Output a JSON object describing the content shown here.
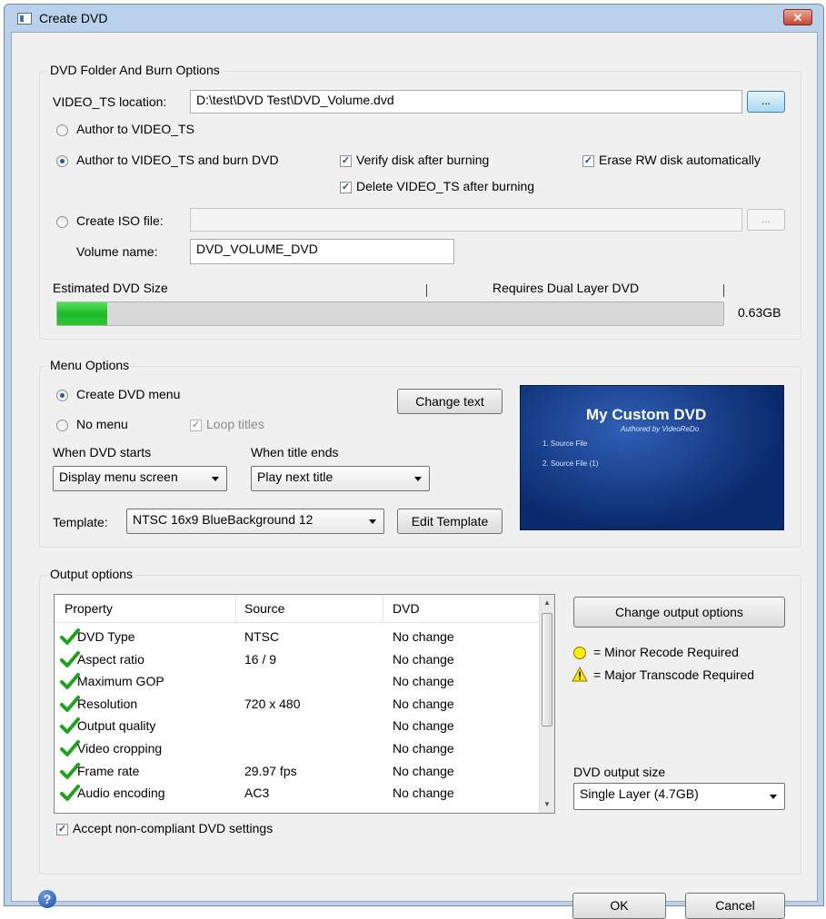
{
  "window": {
    "title": "Create DVD",
    "close_label": "✕"
  },
  "burn_options": {
    "title": "DVD Folder And Burn Options",
    "video_ts_label": "VIDEO_TS location:",
    "video_ts_value": "D:\\test\\DVD Test\\DVD_Volume.dvd",
    "browse_label": "...",
    "author_only_label": "Author to VIDEO_TS",
    "author_burn_label": "Author to VIDEO_TS and burn DVD",
    "verify_label": "Verify disk after burning",
    "erase_rw_label": "Erase RW disk automatically",
    "delete_vts_label": "Delete VIDEO_TS after burning",
    "iso_label": "Create ISO file:",
    "iso_value": "",
    "iso_browse_label": "...",
    "volume_name_label": "Volume name:",
    "volume_name_value": "DVD_VOLUME_DVD",
    "estimated_size_label": "Estimated DVD Size",
    "dual_layer_label": "Requires Dual Layer DVD",
    "size_value": "0.63GB",
    "size_fraction": 0.075
  },
  "menu_options": {
    "title": "Menu Options",
    "create_menu_label": "Create DVD menu",
    "no_menu_label": "No menu",
    "loop_titles_label": "Loop titles",
    "change_text_label": "Change text",
    "when_starts_label": "When DVD starts",
    "when_starts_value": "Display menu screen",
    "when_ends_label": "When title ends",
    "when_ends_value": "Play next title",
    "template_label": "Template:",
    "template_value": "NTSC 16x9 BlueBackground 12",
    "edit_template_label": "Edit Template",
    "preview": {
      "title": "My Custom DVD",
      "subtitle": "Authored by VideoReDo",
      "item1": "1. Source File",
      "item2": "2. Source File (1)"
    }
  },
  "output_options": {
    "title": "Output options",
    "columns": [
      "Property",
      "Source",
      "DVD"
    ],
    "rows": [
      {
        "property": "DVD Type",
        "source": "NTSC",
        "dvd": "No change"
      },
      {
        "property": "Aspect ratio",
        "source": "16 / 9",
        "dvd": "No change"
      },
      {
        "property": "Maximum GOP",
        "source": "",
        "dvd": "No change"
      },
      {
        "property": "Resolution",
        "source": "720 x 480",
        "dvd": "No change"
      },
      {
        "property": "Output quality",
        "source": "",
        "dvd": "No change"
      },
      {
        "property": "Video cropping",
        "source": "",
        "dvd": "No change"
      },
      {
        "property": "Frame rate",
        "source": "29.97 fps",
        "dvd": "No change"
      },
      {
        "property": "Audio encoding",
        "source": "AC3",
        "dvd": "No change"
      }
    ],
    "change_output_label": "Change output options",
    "minor_recode_label": "= Minor Recode Required",
    "major_transcode_label": "= Major Transcode Required",
    "output_size_label": "DVD output size",
    "output_size_value": "Single Layer (4.7GB)",
    "accept_label": "Accept non-compliant DVD settings"
  },
  "footer": {
    "ok_label": "OK",
    "cancel_label": "Cancel",
    "help_glyph": "?"
  }
}
